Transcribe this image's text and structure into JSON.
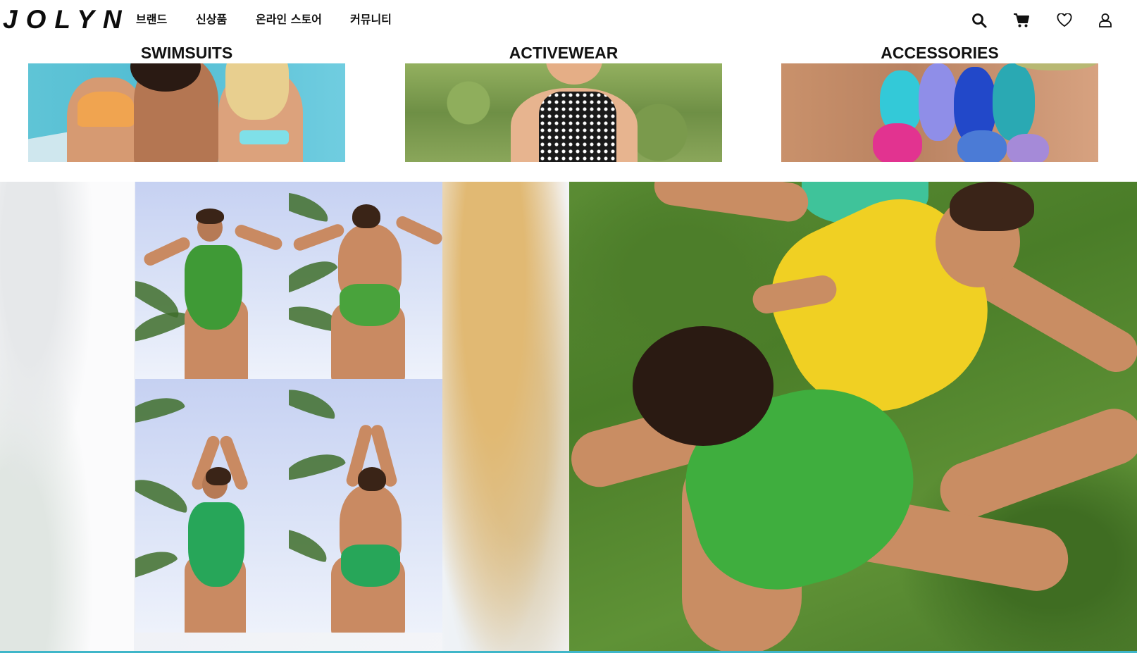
{
  "brand": {
    "logo": "JOLYN"
  },
  "nav": {
    "items": [
      {
        "label": "브랜드"
      },
      {
        "label": "신상품"
      },
      {
        "label": "온라인 스토어"
      },
      {
        "label": "커뮤니티"
      }
    ]
  },
  "header_icons": [
    "search-icon",
    "cart-icon",
    "heart-icon",
    "user-icon"
  ],
  "categories": [
    {
      "title": "SWIMSUITS"
    },
    {
      "title": "ACTIVEWEAR"
    },
    {
      "title": "ACCESSORIES"
    }
  ],
  "colors": {
    "text": "#111111",
    "accent_teal": "#3fb6c9",
    "swim_green": "#3fae3e",
    "swim_yellow": "#f0d023"
  }
}
